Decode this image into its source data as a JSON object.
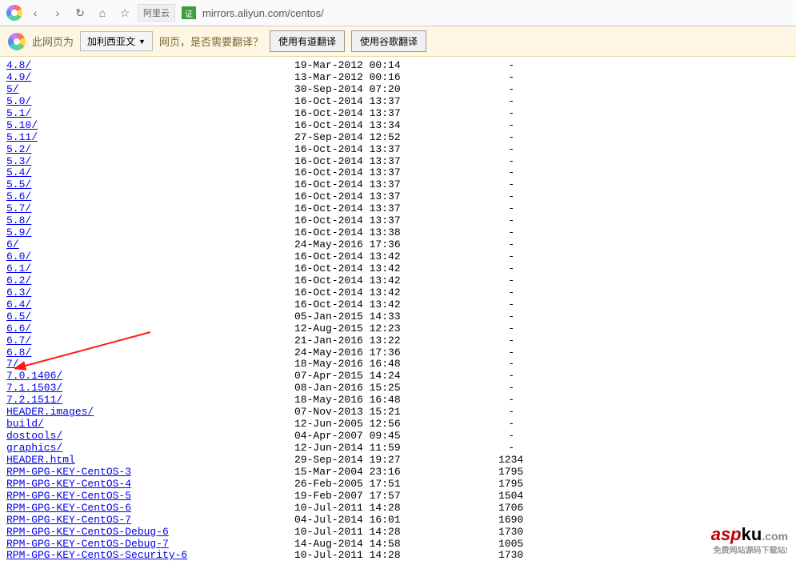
{
  "toolbar": {
    "addr_label": "阿里云",
    "cert_text": "证",
    "url": "mirrors.aliyun.com/centos/"
  },
  "translate": {
    "prefix": "此网页为",
    "lang": "加利西亚文",
    "suffix": "网页，是否需要翻译？",
    "btn_youdao": "使用有道翻译",
    "btn_google": "使用谷歌翻译"
  },
  "listing": [
    {
      "name": "4.8/",
      "date": "19-Mar-2012 00:14",
      "size": "-"
    },
    {
      "name": "4.9/",
      "date": "13-Mar-2012 00:16",
      "size": "-"
    },
    {
      "name": "5/",
      "date": "30-Sep-2014 07:20",
      "size": "-"
    },
    {
      "name": "5.0/",
      "date": "16-Oct-2014 13:37",
      "size": "-"
    },
    {
      "name": "5.1/",
      "date": "16-Oct-2014 13:37",
      "size": "-"
    },
    {
      "name": "5.10/",
      "date": "16-Oct-2014 13:34",
      "size": "-"
    },
    {
      "name": "5.11/",
      "date": "27-Sep-2014 12:52",
      "size": "-"
    },
    {
      "name": "5.2/",
      "date": "16-Oct-2014 13:37",
      "size": "-"
    },
    {
      "name": "5.3/",
      "date": "16-Oct-2014 13:37",
      "size": "-"
    },
    {
      "name": "5.4/",
      "date": "16-Oct-2014 13:37",
      "size": "-"
    },
    {
      "name": "5.5/",
      "date": "16-Oct-2014 13:37",
      "size": "-"
    },
    {
      "name": "5.6/",
      "date": "16-Oct-2014 13:37",
      "size": "-"
    },
    {
      "name": "5.7/",
      "date": "16-Oct-2014 13:37",
      "size": "-"
    },
    {
      "name": "5.8/",
      "date": "16-Oct-2014 13:37",
      "size": "-"
    },
    {
      "name": "5.9/",
      "date": "16-Oct-2014 13:38",
      "size": "-"
    },
    {
      "name": "6/",
      "date": "24-May-2016 17:36",
      "size": "-"
    },
    {
      "name": "6.0/",
      "date": "16-Oct-2014 13:42",
      "size": "-"
    },
    {
      "name": "6.1/",
      "date": "16-Oct-2014 13:42",
      "size": "-"
    },
    {
      "name": "6.2/",
      "date": "16-Oct-2014 13:42",
      "size": "-"
    },
    {
      "name": "6.3/",
      "date": "16-Oct-2014 13:42",
      "size": "-"
    },
    {
      "name": "6.4/",
      "date": "16-Oct-2014 13:42",
      "size": "-"
    },
    {
      "name": "6.5/",
      "date": "05-Jan-2015 14:33",
      "size": "-"
    },
    {
      "name": "6.6/",
      "date": "12-Aug-2015 12:23",
      "size": "-"
    },
    {
      "name": "6.7/",
      "date": "21-Jan-2016 13:22",
      "size": "-"
    },
    {
      "name": "6.8/",
      "date": "24-May-2016 17:36",
      "size": "-"
    },
    {
      "name": "7/",
      "date": "18-May-2016 16:48",
      "size": "-"
    },
    {
      "name": "7.0.1406/",
      "date": "07-Apr-2015 14:24",
      "size": "-"
    },
    {
      "name": "7.1.1503/",
      "date": "08-Jan-2016 15:25",
      "size": "-"
    },
    {
      "name": "7.2.1511/",
      "date": "18-May-2016 16:48",
      "size": "-"
    },
    {
      "name": "HEADER.images/",
      "date": "07-Nov-2013 15:21",
      "size": "-"
    },
    {
      "name": "build/",
      "date": "12-Jun-2005 12:56",
      "size": "-"
    },
    {
      "name": "dostools/",
      "date": "04-Apr-2007 09:45",
      "size": "-"
    },
    {
      "name": "graphics/",
      "date": "12-Jun-2014 11:59",
      "size": "-"
    },
    {
      "name": "HEADER.html",
      "date": "29-Sep-2014 19:27",
      "size": "1234"
    },
    {
      "name": "RPM-GPG-KEY-CentOS-3",
      "date": "15-Mar-2004 23:16",
      "size": "1795"
    },
    {
      "name": "RPM-GPG-KEY-CentOS-4",
      "date": "26-Feb-2005 17:51",
      "size": "1795"
    },
    {
      "name": "RPM-GPG-KEY-CentOS-5",
      "date": "19-Feb-2007 17:57",
      "size": "1504"
    },
    {
      "name": "RPM-GPG-KEY-CentOS-6",
      "date": "10-Jul-2011 14:28",
      "size": "1706"
    },
    {
      "name": "RPM-GPG-KEY-CentOS-7",
      "date": "04-Jul-2014 16:01",
      "size": "1690"
    },
    {
      "name": "RPM-GPG-KEY-CentOS-Debug-6",
      "date": "10-Jul-2011 14:28",
      "size": "1730"
    },
    {
      "name": "RPM-GPG-KEY-CentOS-Debug-7",
      "date": "14-Aug-2014 14:58",
      "size": "1005"
    },
    {
      "name": "RPM-GPG-KEY-CentOS-Security-6",
      "date": "10-Jul-2011 14:28",
      "size": "1730"
    }
  ],
  "watermark": {
    "brand_a": "asp",
    "brand_b": "ku",
    "brand_c": ".com",
    "tagline": "免费网站源码下载站!"
  }
}
